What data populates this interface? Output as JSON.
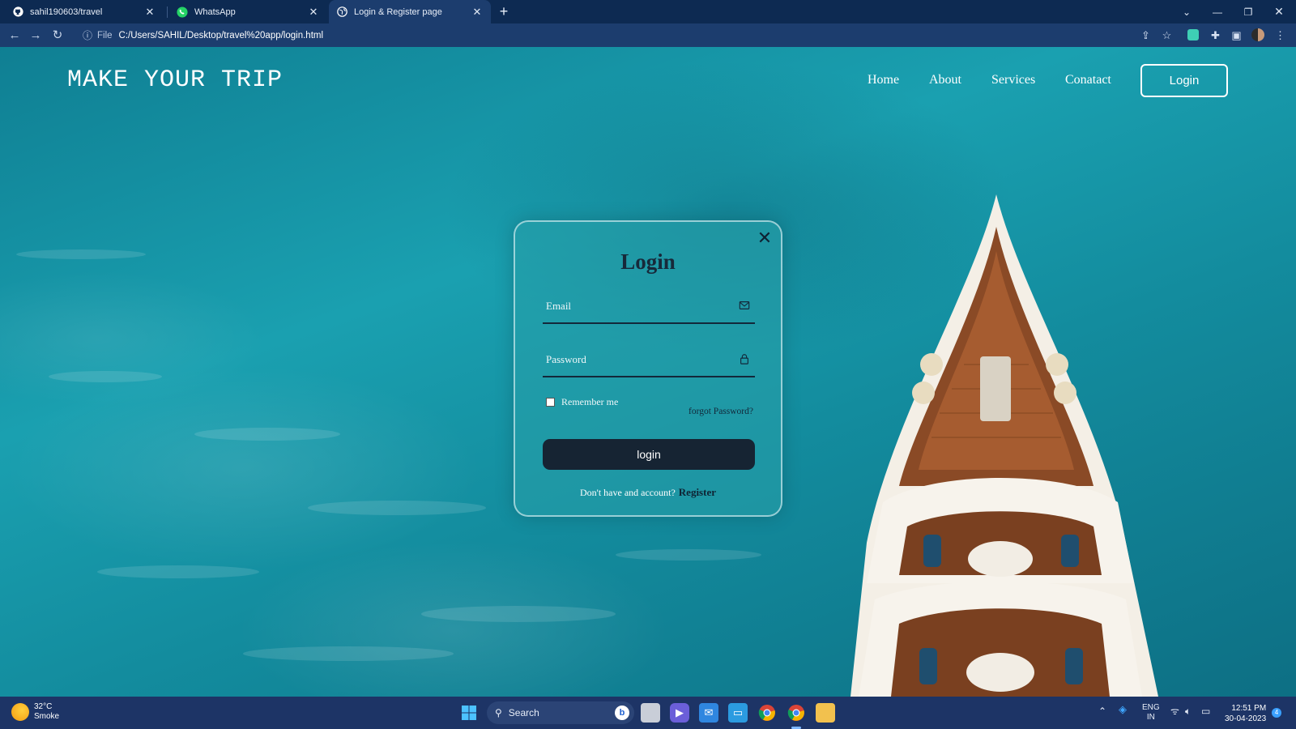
{
  "browser": {
    "tabs": [
      {
        "title": "sahil190603/travel",
        "icon": "github-icon",
        "active": false
      },
      {
        "title": "WhatsApp",
        "icon": "whatsapp-icon",
        "active": false
      },
      {
        "title": "Login & Register page",
        "icon": "globe-icon",
        "active": true
      }
    ],
    "new_tab_label": "+",
    "address": {
      "scheme_label": "File",
      "url": "C:/Users/SAHIL/Desktop/travel%20app/login.html"
    }
  },
  "page": {
    "brand": "MAKE YOUR TRIP",
    "nav": {
      "home": "Home",
      "about": "About",
      "services": "Services",
      "contact": "Conatact",
      "login": "Login"
    },
    "login_card": {
      "title": "Login",
      "email_label": "Email",
      "password_label": "Password",
      "remember_label": "Remember me",
      "remember_checked": false,
      "forgot_label": "forgot Password?",
      "submit_label": "login",
      "register_prompt": "Don't have and account?",
      "register_link": "Register"
    }
  },
  "taskbar": {
    "weather_temp": "32°C",
    "weather_desc": "Smoke",
    "search_label": "Search",
    "language_line1": "ENG",
    "language_line2": "IN",
    "time": "12:51 PM",
    "date": "30-04-2023",
    "notification_count": "4"
  },
  "colors": {
    "browser_tabbar": "#0d2a52",
    "browser_addressbar": "#1c3d6e",
    "sea": "#1aa0b0",
    "card_button": "#162433",
    "taskbar": "#1d3466"
  }
}
